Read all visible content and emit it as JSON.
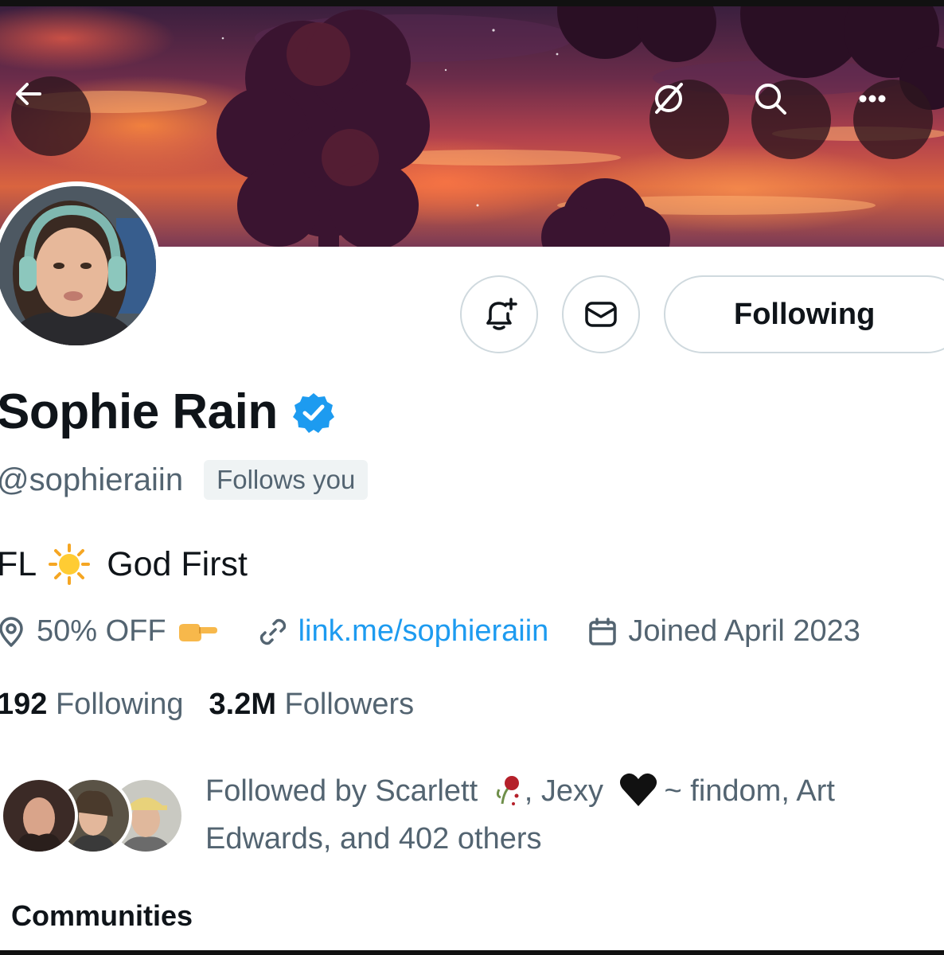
{
  "header": {
    "back_icon": "arrow-left-icon",
    "grok_icon": "slashed-circle-icon",
    "search_icon": "search-icon",
    "more_icon": "more-horizontal-icon"
  },
  "actions": {
    "notify_icon": "bell-plus-icon",
    "message_icon": "envelope-icon",
    "follow_label": "Following"
  },
  "profile": {
    "name": "Sophie Rain",
    "verified_icon": "verified-badge-icon",
    "handle": "@sophieraiin",
    "follows_you": "Follows you",
    "bio_prefix": "FL",
    "bio_emoji": "sun-emoji",
    "bio_suffix": "God First",
    "location": "50% OFF",
    "location_emoji": "pointing-hand-emoji",
    "link": "link.me/sophieraiin",
    "joined": "Joined April 2023"
  },
  "stats": {
    "following_count": "192",
    "following_label": "Following",
    "followers_count": "3.2M",
    "followers_label": "Followers"
  },
  "followed_by": {
    "prefix": "Followed by Scarlett",
    "rose_emoji": "wilted-rose-emoji",
    "mid": ", Jexy",
    "heart_emoji": "black-heart-emoji",
    "suffix_1": "~ findom, Art",
    "suffix_2": "Edwards, and 402 others"
  },
  "sections": {
    "communities": "Communities"
  },
  "colors": {
    "accent": "#1d9bf0",
    "secondary_text": "#536471",
    "primary_text": "#0f1419",
    "border": "#cfd9de"
  }
}
